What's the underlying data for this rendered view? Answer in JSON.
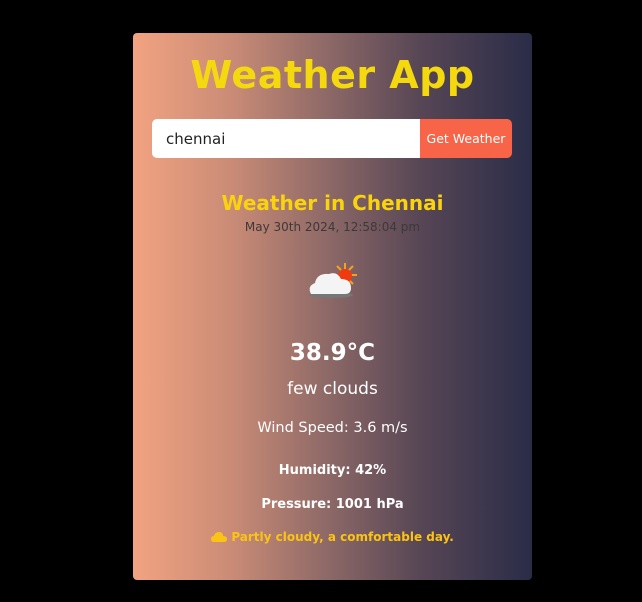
{
  "app": {
    "title": "Weather App"
  },
  "search": {
    "value": "chennai",
    "button_label": "Get Weather"
  },
  "weather": {
    "heading": "Weather in Chennai",
    "datetime": "May 30th 2024, 12:58:04 pm",
    "icon": "partly-cloudy-icon",
    "temperature": "38.9°C",
    "description": "few clouds",
    "wind": "Wind Speed: 3.6 m/s",
    "humidity": "Humidity: 42%",
    "pressure": "Pressure: 1001 hPa",
    "message": "Partly cloudy, a comfortable day.",
    "message_icon": "cloud-icon"
  },
  "colors": {
    "accent": "#f5d90f",
    "button": "#f76448",
    "message": "#fbc313"
  }
}
